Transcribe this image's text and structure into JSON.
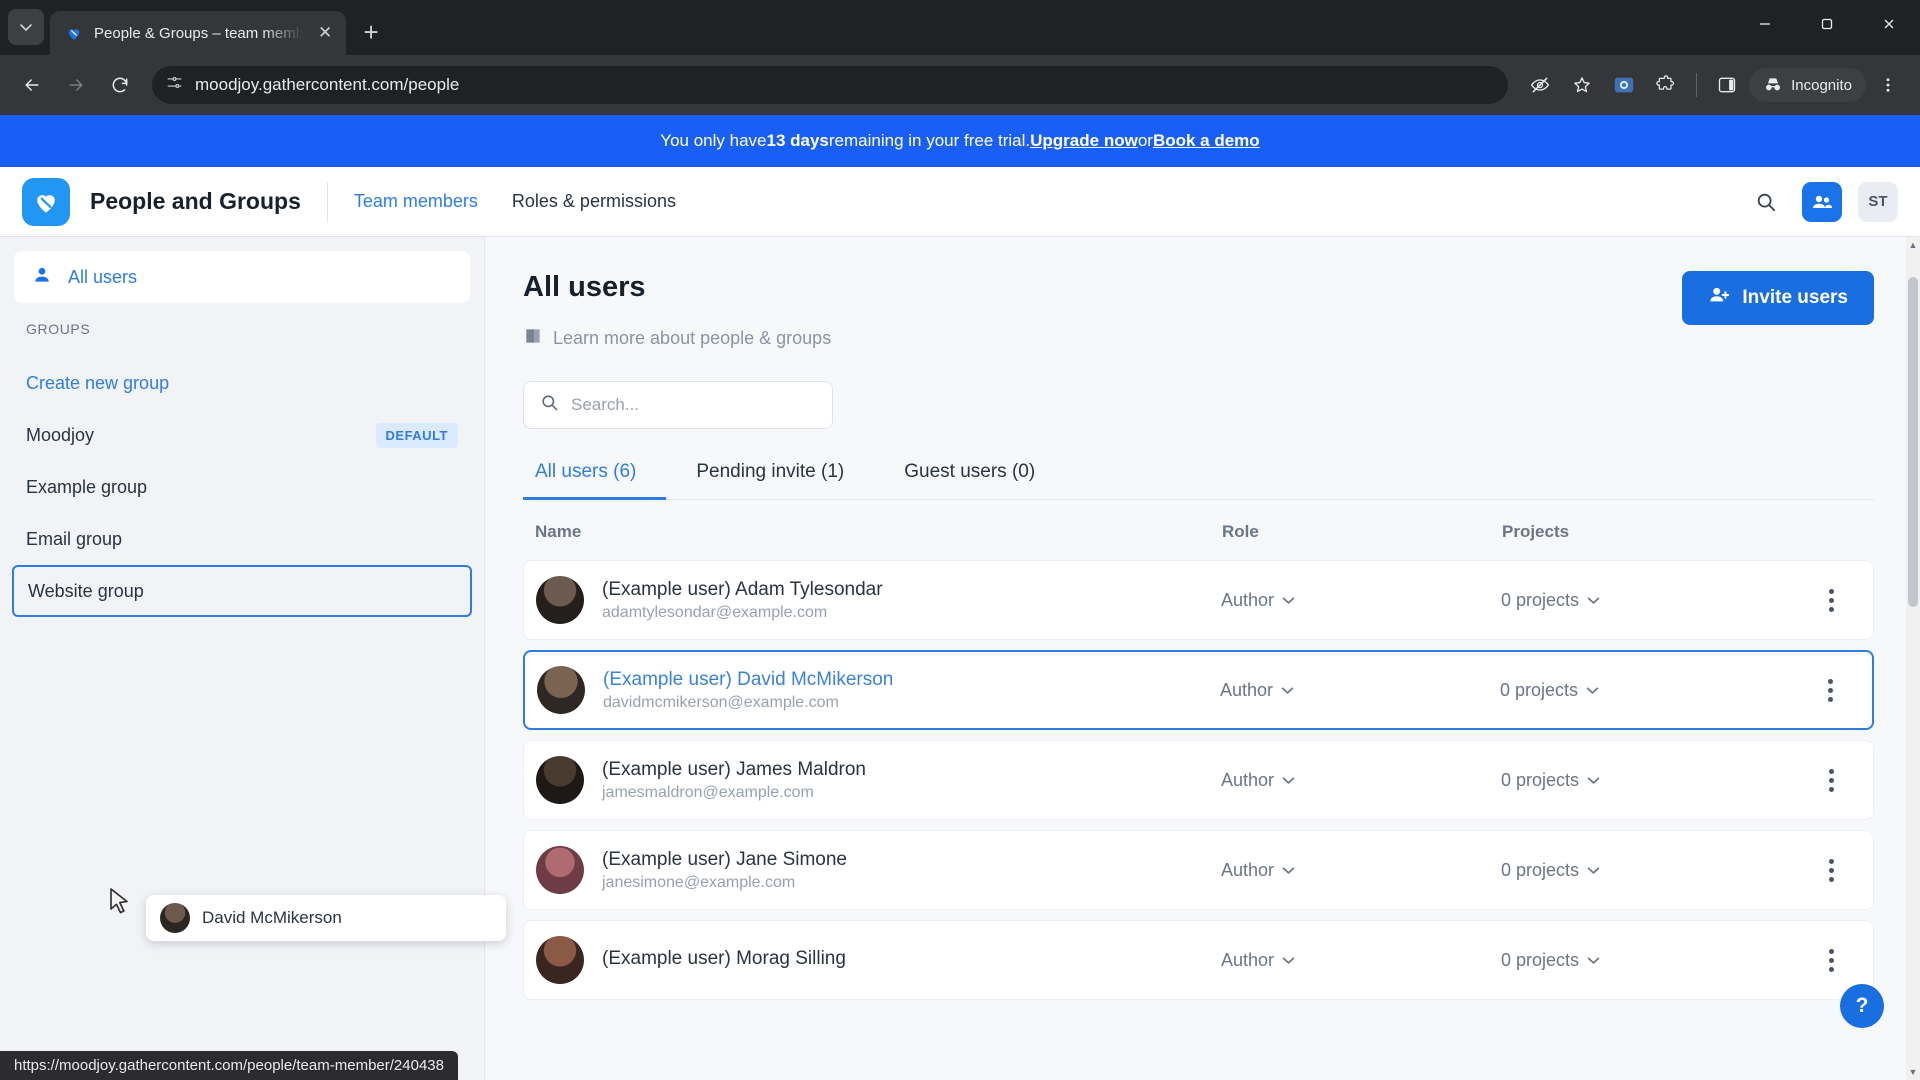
{
  "browser": {
    "tab": {
      "title": "People & Groups – team memb",
      "favicon": "gathercontent-heart-icon",
      "close_label": "✕"
    },
    "new_tab_label": "+",
    "window_controls": {
      "minimize": "—",
      "maximize": "▢",
      "close": "✕"
    },
    "nav": {
      "back": "←",
      "forward": "→",
      "reload": "⟳"
    },
    "omnibox": {
      "url": "moodjoy.gathercontent.com/people",
      "site_info_icon": "tune-icon"
    },
    "toolbar_right": {
      "tracking_protection": "eye-off-icon",
      "bookmark": "star-icon",
      "extensions": "puzzle-icon",
      "split_view": "side-panel-icon",
      "profile_label": "Incognito",
      "menu": "three-dot-icon"
    },
    "status_url": "https://moodjoy.gathercontent.com/people/team-member/240438"
  },
  "banner": {
    "prefix": "You only have ",
    "days": "13 days",
    "middle": " remaining in your free trial. ",
    "link1": "Upgrade now",
    "conjunction": " or ",
    "link2": "Book a demo",
    "bg_color": "#1a5ff5"
  },
  "app_header": {
    "logo": "gathercontent-logo-icon",
    "title": "People and Groups",
    "nav": [
      {
        "label": "Team members",
        "active": true
      },
      {
        "label": "Roles & permissions",
        "active": false
      }
    ],
    "search_icon": "search-icon",
    "people_icon": "people-icon",
    "avatar_initials": "ST"
  },
  "sidebar": {
    "all_users": {
      "label": "All users",
      "icon": "person-icon"
    },
    "groups_heading": "GROUPS",
    "groups": [
      {
        "label": "Create new group",
        "type": "link"
      },
      {
        "label": "Moodjoy",
        "badge": "DEFAULT"
      },
      {
        "label": "Example group"
      },
      {
        "label": "Email group"
      },
      {
        "label": "Website group",
        "drop_target": true
      }
    ]
  },
  "drag": {
    "ghost_label": "David McMikerson",
    "cursor": "drag-cursor"
  },
  "main": {
    "title": "All users",
    "learn_more": {
      "label": "Learn more about people & groups",
      "icon": "book-icon"
    },
    "invite_button": {
      "label": "Invite users",
      "icon": "add-person-icon"
    },
    "search": {
      "placeholder": "Search...",
      "value": "",
      "icon": "search-icon"
    },
    "tabs": [
      {
        "label": "All users (6)",
        "active": true
      },
      {
        "label": "Pending invite (1)",
        "active": false
      },
      {
        "label": "Guest users (0)",
        "active": false
      }
    ],
    "table": {
      "columns": [
        "Name",
        "Role",
        "Projects"
      ],
      "rows": [
        {
          "name": "(Example user) Adam Tylesondar",
          "email": "adamtylesondar@example.com",
          "role": "Author",
          "projects": "0 projects",
          "selected": false,
          "avatar_color": "#4a3c32"
        },
        {
          "name": "(Example user) David McMikerson",
          "email": "davidmcmikerson@example.com",
          "role": "Author",
          "projects": "0 projects",
          "selected": true,
          "avatar_color": "#5d4a3a"
        },
        {
          "name": "(Example user) James Maldron",
          "email": "jamesmaldron@example.com",
          "role": "Author",
          "projects": "0 projects",
          "selected": false,
          "avatar_color": "#2b2622"
        },
        {
          "name": "(Example user) Jane Simone",
          "email": "janesimone@example.com",
          "role": "Author",
          "projects": "0 projects",
          "selected": false,
          "avatar_color": "#8a4a55"
        },
        {
          "name": "(Example user) Morag Silling",
          "email": "",
          "role": "Author",
          "projects": "0 projects",
          "selected": false,
          "avatar_color": "#6a3f33"
        }
      ]
    },
    "help_fab": "?"
  },
  "colors": {
    "accent": "#2f7de1",
    "banner": "#1a5ff5",
    "primary_button": "#1a6fe0",
    "logo": "#2196f3"
  }
}
